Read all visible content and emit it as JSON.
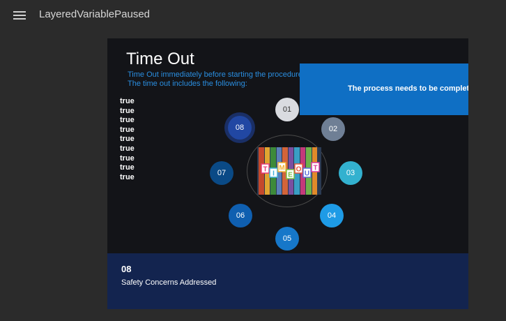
{
  "app": {
    "title": "LayeredVariablePaused"
  },
  "slide": {
    "title": "Time Out",
    "description_line1": "Time Out immediately before starting the procedure",
    "description_line2": "The time out includes the following:",
    "callout": "The process needs to be completed before",
    "checklist": [
      "true",
      "true",
      "true",
      "true",
      "true",
      "true",
      "true",
      "true",
      "true"
    ],
    "image_letters": [
      "T",
      "I",
      "M",
      "E",
      "O",
      "U",
      "T"
    ],
    "nodes": [
      {
        "label": "01",
        "color": "#d9dbe0",
        "text_color": "#333333"
      },
      {
        "label": "02",
        "color": "#6f7f95",
        "text_color": "#ffffff"
      },
      {
        "label": "03",
        "color": "#33b1cf",
        "text_color": "#ffffff"
      },
      {
        "label": "04",
        "color": "#1e9be6",
        "text_color": "#ffffff"
      },
      {
        "label": "05",
        "color": "#1677c9",
        "text_color": "#ffffff"
      },
      {
        "label": "06",
        "color": "#0f5fb0",
        "text_color": "#ffffff"
      },
      {
        "label": "07",
        "color": "#0a4a86",
        "text_color": "#ffffff"
      },
      {
        "label": "08",
        "color": "#2147a3",
        "text_color": "#ffffff",
        "active": true
      }
    ],
    "detail": {
      "number": "08",
      "label": "Safety Concerns Addressed"
    }
  }
}
